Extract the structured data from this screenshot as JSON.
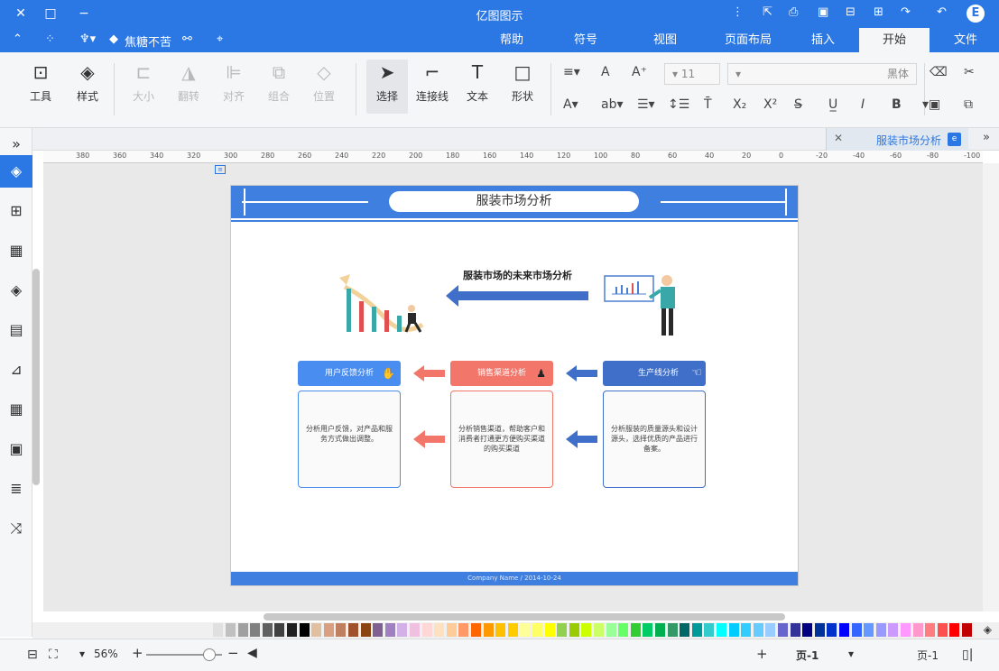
{
  "window": {
    "title": "亿图图示",
    "logo": "E"
  },
  "menu": {
    "tabs": [
      "文件",
      "开始",
      "插入",
      "页面布局",
      "视图",
      "符号",
      "帮助"
    ],
    "active_tab": "开始",
    "user_label": "焦糖不苦"
  },
  "ribbon": {
    "tools": [
      {
        "label": "工具",
        "icon": "tools-icon"
      },
      {
        "label": "样式",
        "icon": "fill-icon"
      },
      {
        "label": "大小",
        "icon": "size-icon"
      },
      {
        "label": "翻转",
        "icon": "flip-icon"
      },
      {
        "label": "对齐",
        "icon": "align-icon"
      },
      {
        "label": "组合",
        "icon": "group-icon"
      },
      {
        "label": "位置",
        "icon": "position-icon"
      },
      {
        "label": "选择",
        "icon": "pointer-icon"
      },
      {
        "label": "连接线",
        "icon": "connector-icon"
      },
      {
        "label": "文本",
        "icon": "text-icon"
      },
      {
        "label": "形状",
        "icon": "shape-icon"
      }
    ],
    "font_name": "黑体",
    "font_size": "11"
  },
  "document": {
    "tab_name": "服装市场分析",
    "page_title": "服装市场分析",
    "subtitle": "服装市场的未来市场分析",
    "footer": "Company Name / 2014-10-24",
    "boxes": [
      {
        "header": "生产线分析",
        "body": "分析服装的质量源头和设计源头，选择优质的产品进行备案。",
        "color": "#3f6fc8"
      },
      {
        "header": "销售渠道分析",
        "body": "分析销售渠道，帮助客户和消费者打通更方便购买渠道的购买渠道",
        "color": "#f2766a"
      },
      {
        "header": "用户反馈分析",
        "body": "分析用户反馈，对产品和服务方式做出调整。",
        "color": "#4a8df0"
      }
    ]
  },
  "ruler": {
    "ticks": [
      "-100",
      "-80",
      "-60",
      "-40",
      "-20",
      "0",
      "20",
      "40",
      "60",
      "80",
      "100",
      "120",
      "140",
      "160",
      "180",
      "200",
      "220",
      "240",
      "260",
      "280",
      "300",
      "320",
      "340",
      "360",
      "380"
    ]
  },
  "statusbar": {
    "page_label": "页-1",
    "page_tab": "页-1",
    "zoom": "56%"
  },
  "palette": [
    "#c00000",
    "#ff0000",
    "#ff5050",
    "#ff7c80",
    "#ff99cc",
    "#ff99ff",
    "#cc99ff",
    "#9999ff",
    "#6699ff",
    "#3366ff",
    "#0000ff",
    "#0033cc",
    "#003399",
    "#000080",
    "#333399",
    "#6666cc",
    "#99ccff",
    "#66ccff",
    "#33ccff",
    "#00ccff",
    "#00ffff",
    "#33cccc",
    "#009999",
    "#006666",
    "#339966",
    "#00b050",
    "#00cc66",
    "#33cc33",
    "#66ff66",
    "#99ff99",
    "#ccff66",
    "#ccff00",
    "#99cc00",
    "#92d050",
    "#ffff00",
    "#ffff66",
    "#ffff99",
    "#ffcc00",
    "#ffc000",
    "#ff9900",
    "#ff6600",
    "#ff9966",
    "#ffcc99",
    "#ffe0c0",
    "#ffd7d7",
    "#f0c0e0",
    "#d4b0e8",
    "#a080c0",
    "#806090",
    "#8b4513",
    "#a0522d",
    "#c08060",
    "#d8a080",
    "#e0c0a0",
    "#000000",
    "#202020",
    "#404040",
    "#606060",
    "#808080",
    "#a0a0a0",
    "#c0c0c0",
    "#e0e0e0"
  ]
}
